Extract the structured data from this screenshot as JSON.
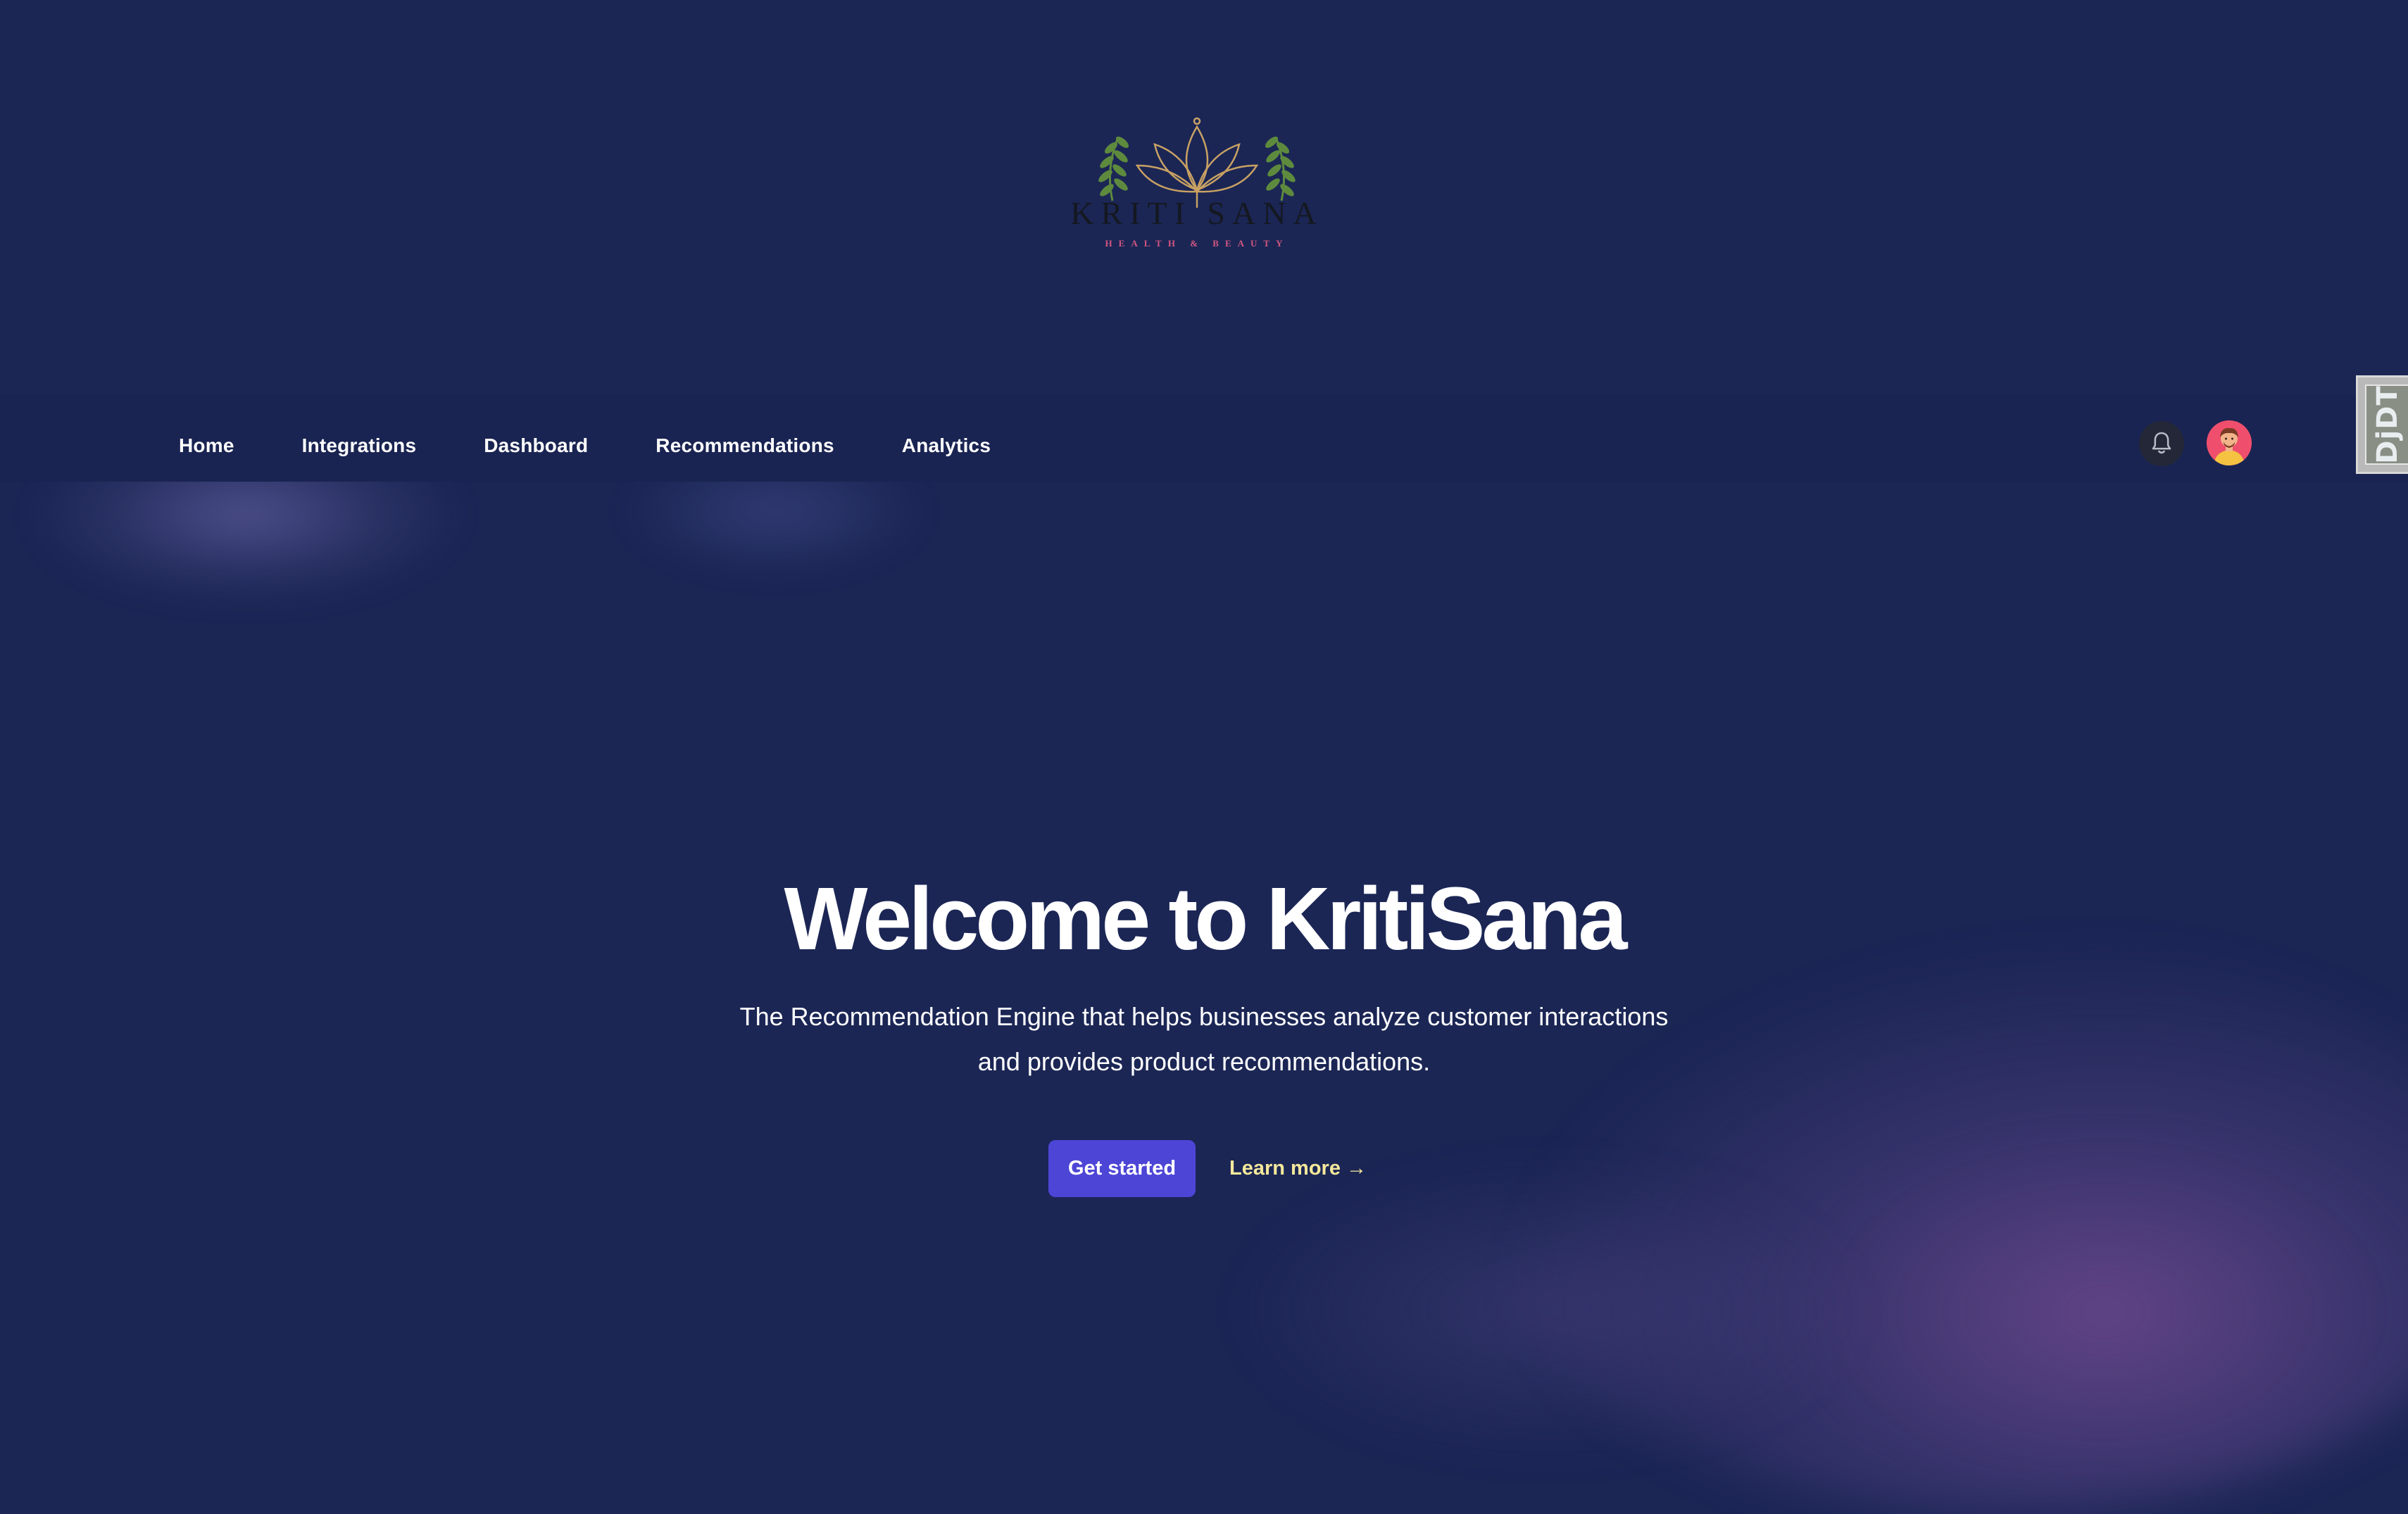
{
  "brand": {
    "logo_name": "KRITI SANA",
    "logo_tagline": "HEALTH & BEAUTY",
    "logo_gold": "#c8a163",
    "logo_green": "#5e8a3e",
    "logo_pink": "#d2567f"
  },
  "nav": {
    "items": [
      {
        "label": "Home"
      },
      {
        "label": "Integrations"
      },
      {
        "label": "Dashboard"
      },
      {
        "label": "Recommendations"
      },
      {
        "label": "Analytics"
      }
    ],
    "notification_icon": "bell-icon",
    "avatar_icon": "user-avatar"
  },
  "debug_toolbar": {
    "label": "DjDT"
  },
  "hero": {
    "title": "Welcome to KritiSana",
    "subtitle_line1": "The Recommendation Engine that helps businesses analyze customer interactions",
    "subtitle_line2": "and provides product recommendations.",
    "primary_cta": "Get started",
    "secondary_cta": "Learn more",
    "secondary_cta_arrow": "→"
  },
  "colors": {
    "background": "#1b2655",
    "navbar": "#1a2452",
    "primary_button": "#4d45d6",
    "link_accent": "#f5e89a"
  }
}
